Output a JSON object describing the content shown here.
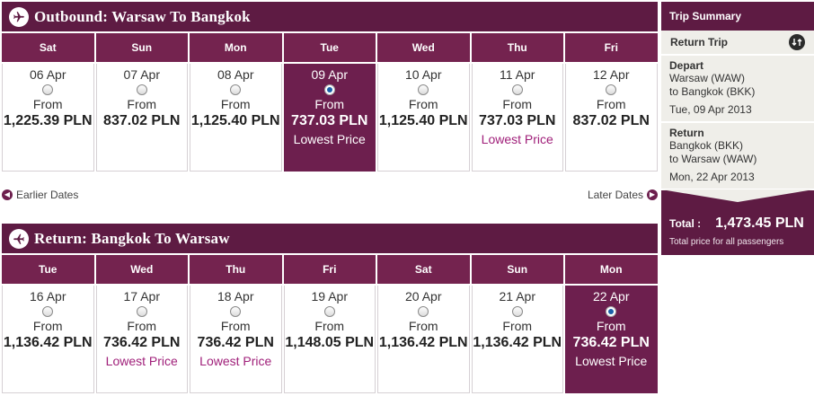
{
  "outbound": {
    "title": "Outbound: Warsaw To Bangkok",
    "days": [
      {
        "day": "Sat",
        "date": "06 Apr",
        "from": "From",
        "price": "1,225.39 PLN",
        "note": "",
        "selected": false
      },
      {
        "day": "Sun",
        "date": "07 Apr",
        "from": "From",
        "price": "837.02 PLN",
        "note": "",
        "selected": false
      },
      {
        "day": "Mon",
        "date": "08 Apr",
        "from": "From",
        "price": "1,125.40 PLN",
        "note": "",
        "selected": false
      },
      {
        "day": "Tue",
        "date": "09 Apr",
        "from": "From",
        "price": "737.03 PLN",
        "note": "Lowest Price",
        "selected": true
      },
      {
        "day": "Wed",
        "date": "10 Apr",
        "from": "From",
        "price": "1,125.40 PLN",
        "note": "",
        "selected": false
      },
      {
        "day": "Thu",
        "date": "11 Apr",
        "from": "From",
        "price": "737.03 PLN",
        "note": "Lowest Price",
        "selected": false
      },
      {
        "day": "Fri",
        "date": "12 Apr",
        "from": "From",
        "price": "837.02 PLN",
        "note": "",
        "selected": false
      }
    ]
  },
  "nav": {
    "earlier": "Earlier Dates",
    "later": "Later Dates"
  },
  "return": {
    "title": "Return: Bangkok To Warsaw",
    "days": [
      {
        "day": "Tue",
        "date": "16 Apr",
        "from": "From",
        "price": "1,136.42 PLN",
        "note": "",
        "selected": false
      },
      {
        "day": "Wed",
        "date": "17 Apr",
        "from": "From",
        "price": "736.42 PLN",
        "note": "Lowest Price",
        "selected": false
      },
      {
        "day": "Thu",
        "date": "18 Apr",
        "from": "From",
        "price": "736.42 PLN",
        "note": "Lowest Price",
        "selected": false
      },
      {
        "day": "Fri",
        "date": "19 Apr",
        "from": "From",
        "price": "1,148.05 PLN",
        "note": "",
        "selected": false
      },
      {
        "day": "Sat",
        "date": "20 Apr",
        "from": "From",
        "price": "1,136.42 PLN",
        "note": "",
        "selected": false
      },
      {
        "day": "Sun",
        "date": "21 Apr",
        "from": "From",
        "price": "1,136.42 PLN",
        "note": "",
        "selected": false
      },
      {
        "day": "Mon",
        "date": "22 Apr",
        "from": "From",
        "price": "736.42 PLN",
        "note": "Lowest Price",
        "selected": true
      }
    ]
  },
  "summary": {
    "title": "Trip Summary",
    "trip_type": "Return Trip",
    "depart": {
      "label": "Depart",
      "line1": "Warsaw (WAW)",
      "line2": "to Bangkok (BKK)",
      "date": "Tue, 09 Apr 2013"
    },
    "return_leg": {
      "label": "Return",
      "line1": "Bangkok (BKK)",
      "line2": "to Warsaw (WAW)",
      "date": "Mon, 22 Apr 2013"
    },
    "total_label": "Total :",
    "total_value": "1,473.45 PLN",
    "total_note": "Total price for all passengers"
  },
  "icons": {
    "section": "plane-icon",
    "trip_type": "swap-icon"
  },
  "colors": {
    "primary": "#5e1b43",
    "selected": "#6d1f4e",
    "lowest_price": "#a0207a",
    "summary_bg": "#efeee9"
  }
}
